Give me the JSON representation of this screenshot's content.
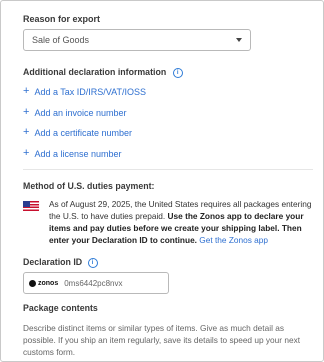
{
  "reason": {
    "label": "Reason for export",
    "selected": "Sale of Goods"
  },
  "additional": {
    "label": "Additional declaration information",
    "links": [
      "Add a Tax ID/IRS/VAT/IOSS",
      "Add an invoice number",
      "Add a certificate number",
      "Add a license number"
    ]
  },
  "duties": {
    "label": "Method of U.S. duties payment:",
    "text_plain": "As of August 29, 2025, the United States requires all packages entering the U.S. to have duties prepaid.",
    "text_bold": "Use the Zonos app to declare your items and pay duties before we create your shipping label. Then enter your Declaration ID to continue.",
    "link": "Get the Zonos app"
  },
  "declaration": {
    "label": "Declaration ID",
    "logo_text": "zonos",
    "value": "0ms6442pc8nvx"
  },
  "package": {
    "label": "Package contents",
    "description": "Describe distinct items or similar types of items. Give as much detail as possible. If you ship an item regularly, save its details to speed up your next customs form."
  },
  "icons": {
    "info": "info-icon",
    "plus": "plus-icon",
    "caret": "chevron-down-icon",
    "flag": "us-flag-icon"
  },
  "colors": {
    "link": "#2e6fd0",
    "text": "#333333",
    "muted": "#666666",
    "border": "#b9b9b9"
  }
}
